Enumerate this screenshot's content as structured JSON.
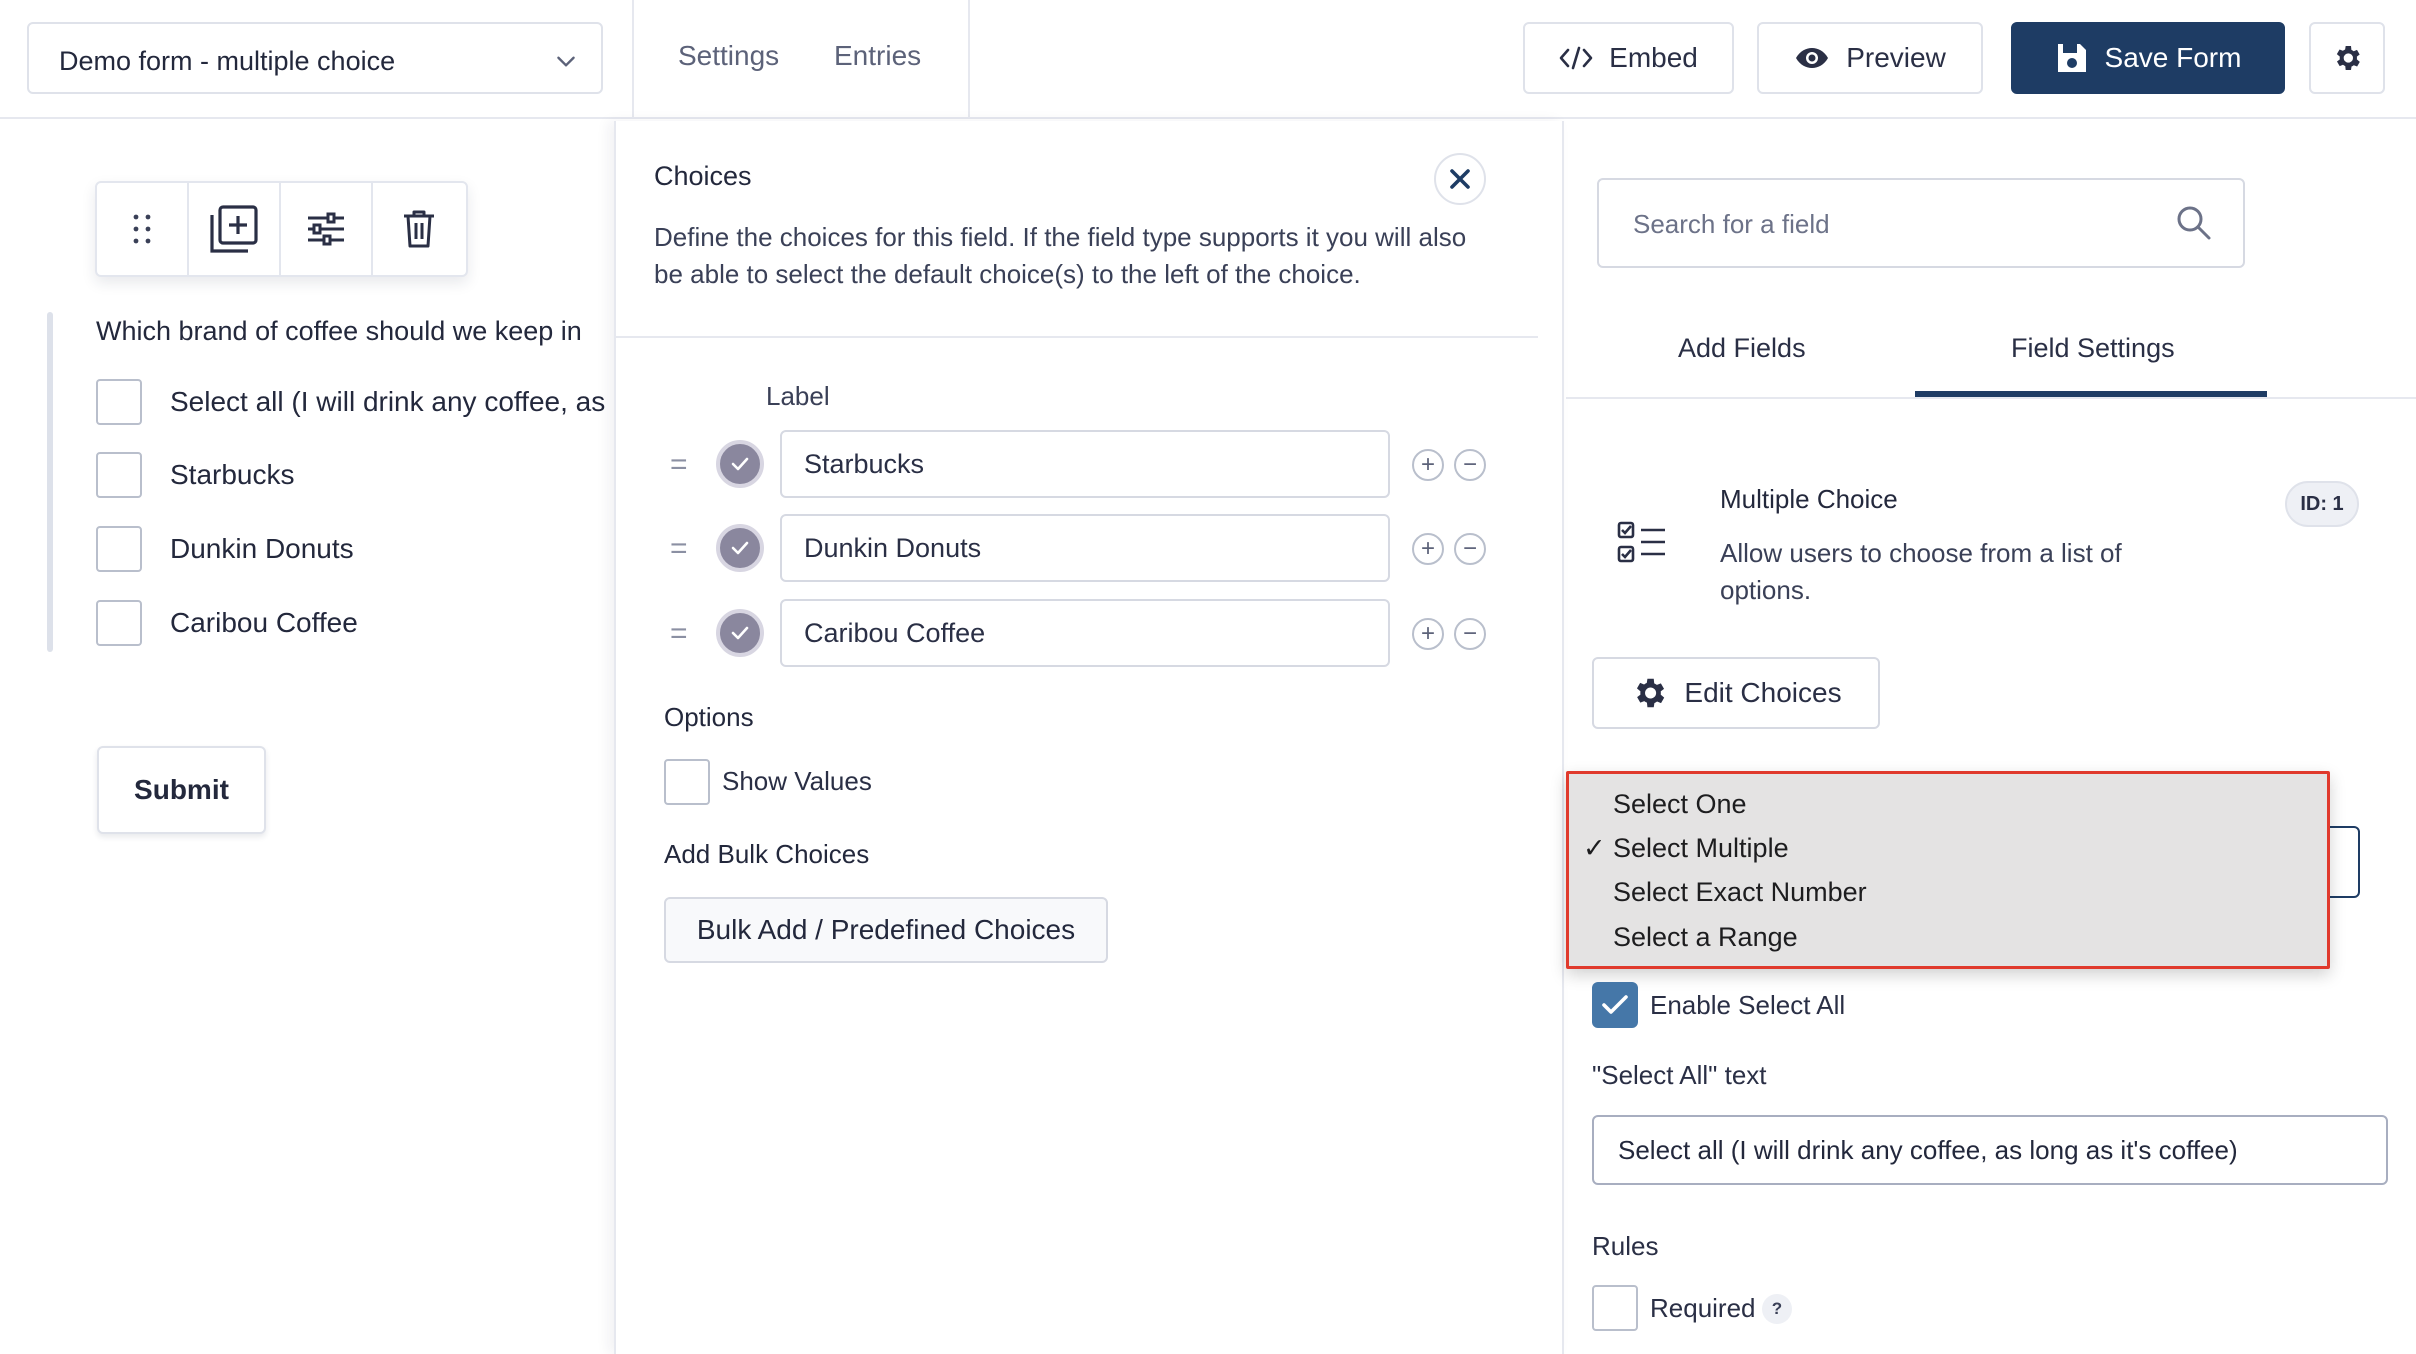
{
  "header": {
    "form_name": "Demo form - multiple choice",
    "nav": [
      "Settings",
      "Entries"
    ],
    "embed_label": "Embed",
    "preview_label": "Preview",
    "save_label": "Save Form"
  },
  "canvas": {
    "question": "Which brand of coffee should we keep in",
    "options": [
      "Select all (I will drink any coffee, as",
      "Starbucks",
      "Dunkin Donuts",
      "Caribou Coffee"
    ],
    "submit_label": "Submit"
  },
  "choices_panel": {
    "title": "Choices",
    "description": "Define the choices for this field. If the field type supports it you will also be able to select the default choice(s) to the left of the choice.",
    "label_header": "Label",
    "drag_symbol": "=",
    "plus_symbol": "+",
    "minus_symbol": "−",
    "choices": [
      "Starbucks",
      "Dunkin Donuts",
      "Caribou Coffee"
    ],
    "options_title": "Options",
    "show_values_label": "Show Values",
    "bulk_title": "Add Bulk Choices",
    "bulk_button": "Bulk Add / Predefined Choices"
  },
  "sidebar": {
    "search_placeholder": "Search for a field",
    "tabs": [
      "Add Fields",
      "Field Settings"
    ],
    "active_tab": "Field Settings",
    "field_title": "Multiple Choice",
    "field_desc": "Allow users to choose from a list of options.",
    "id_badge": "ID: 1",
    "edit_choices_label": "Edit Choices",
    "dropdown_options": [
      "Select One",
      "Select Multiple",
      "Select Exact Number",
      "Select a Range"
    ],
    "dropdown_selected": "Select Multiple",
    "checkmark": "✓",
    "enable_select_all_label": "Enable Select All",
    "select_all_text_label": "\"Select All\" text",
    "select_all_text_value": "Select all (I will drink any coffee, as long as it's coffee)",
    "rules_label": "Rules",
    "required_label": "Required",
    "help_symbol": "?"
  },
  "colors": {
    "primary": "#1e3c64",
    "checkbox_checked": "#4577a8",
    "highlight_border": "#e03a2d"
  }
}
